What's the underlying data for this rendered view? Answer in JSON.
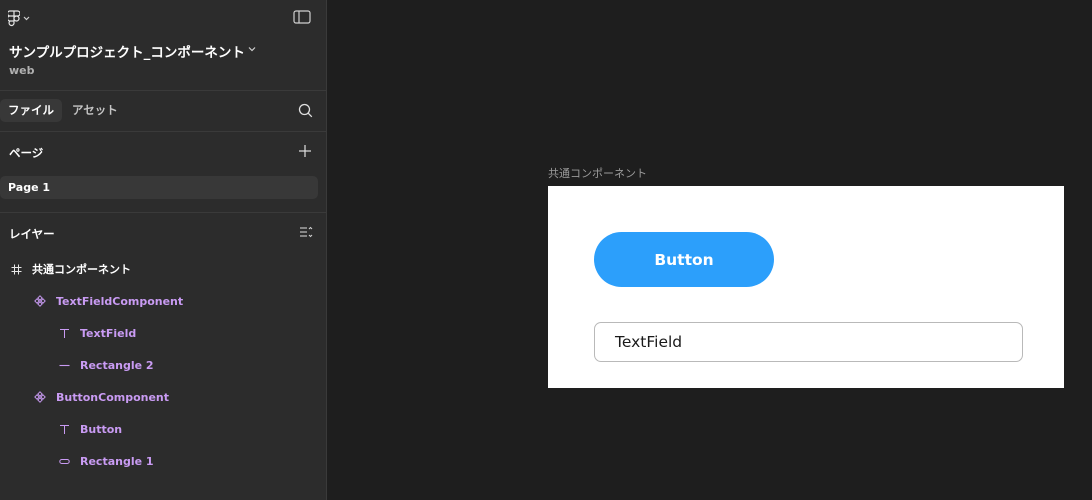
{
  "project": {
    "title": "サンプルプロジェクト_コンポーネント",
    "subtitle": "web"
  },
  "tabs": [
    {
      "label": "ファイル"
    },
    {
      "label": "アセット"
    }
  ],
  "pages": {
    "title": "ページ",
    "items": [
      {
        "label": "Page 1"
      }
    ]
  },
  "layers": {
    "title": "レイヤー",
    "items": [
      {
        "label": "共通コンポーネント",
        "icon": "frame-icon"
      },
      {
        "label": "TextFieldComponent",
        "icon": "component-icon"
      },
      {
        "label": "TextField",
        "icon": "text-icon"
      },
      {
        "label": "Rectangle 2",
        "icon": "line-icon"
      },
      {
        "label": "ButtonComponent",
        "icon": "component-icon"
      },
      {
        "label": "Button",
        "icon": "text-icon"
      },
      {
        "label": "Rectangle 1",
        "icon": "rectangle-icon"
      }
    ]
  },
  "canvas": {
    "frame_label": "共通コンポーネント",
    "button_label": "Button",
    "textfield_value": "TextField"
  },
  "colors": {
    "accent": "#2c9ffb",
    "component": "#c99bf3",
    "sidebar": "#2c2c2c",
    "canvas": "#1e1e1e"
  }
}
